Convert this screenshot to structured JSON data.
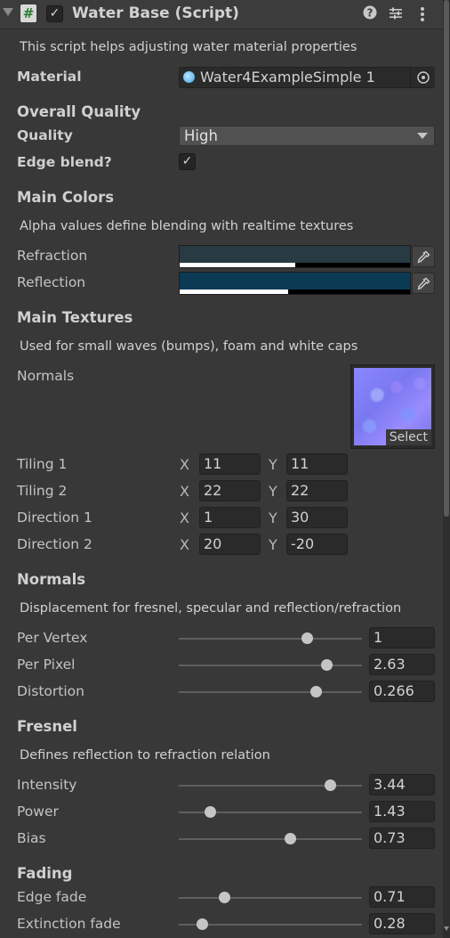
{
  "header": {
    "title": "Water Base (Script)",
    "enabled": true,
    "icons": [
      "foldout-arrow",
      "script-icon",
      "help-icon",
      "presets-icon",
      "more-icon"
    ]
  },
  "intro_help": "This script helps adjusting water material properties",
  "material": {
    "label": "Material",
    "value": "Water4ExampleSimple 1"
  },
  "overall_quality": {
    "heading": "Overall Quality",
    "quality_label": "Quality",
    "quality_value": "High",
    "edge_blend_label": "Edge blend?",
    "edge_blend_checked": true
  },
  "main_colors": {
    "heading": "Main Colors",
    "help": "Alpha values define blending with realtime textures",
    "refraction": {
      "label": "Refraction",
      "color": "#283a42",
      "alpha": 0.5
    },
    "reflection": {
      "label": "Reflection",
      "color": "#0b3a55",
      "alpha": 0.47
    }
  },
  "main_textures": {
    "heading": "Main Textures",
    "help": "Used for small waves (bumps), foam and white caps",
    "normals_label": "Normals",
    "select_label": "Select",
    "vectors": [
      {
        "label": "Tiling 1",
        "x": "11",
        "y": "11"
      },
      {
        "label": "Tiling 2",
        "x": "22",
        "y": "22"
      },
      {
        "label": "Direction 1",
        "x": "1",
        "y": "30"
      },
      {
        "label": "Direction 2",
        "x": "20",
        "y": "-20"
      }
    ],
    "axis_x": "X",
    "axis_y": "Y"
  },
  "normals": {
    "heading": "Normals",
    "help": "Displacement for fresnel, specular and reflection/refraction",
    "sliders": [
      {
        "label": "Per Vertex",
        "value": "1",
        "position": 0.7
      },
      {
        "label": "Per Pixel",
        "value": "2.63",
        "position": 0.81
      },
      {
        "label": "Distortion",
        "value": "0.266",
        "position": 0.75
      }
    ]
  },
  "fresnel": {
    "heading": "Fresnel",
    "help": "Defines reflection to refraction relation",
    "sliders": [
      {
        "label": "Intensity",
        "value": "3.44",
        "position": 0.83
      },
      {
        "label": "Power",
        "value": "1.43",
        "position": 0.17
      },
      {
        "label": "Bias",
        "value": "0.73",
        "position": 0.61
      }
    ]
  },
  "fading": {
    "heading": "Fading",
    "sliders": [
      {
        "label": "Edge fade",
        "value": "0.71",
        "position": 0.25
      },
      {
        "label": "Extinction fade",
        "value": "0.28",
        "position": 0.13
      }
    ]
  }
}
